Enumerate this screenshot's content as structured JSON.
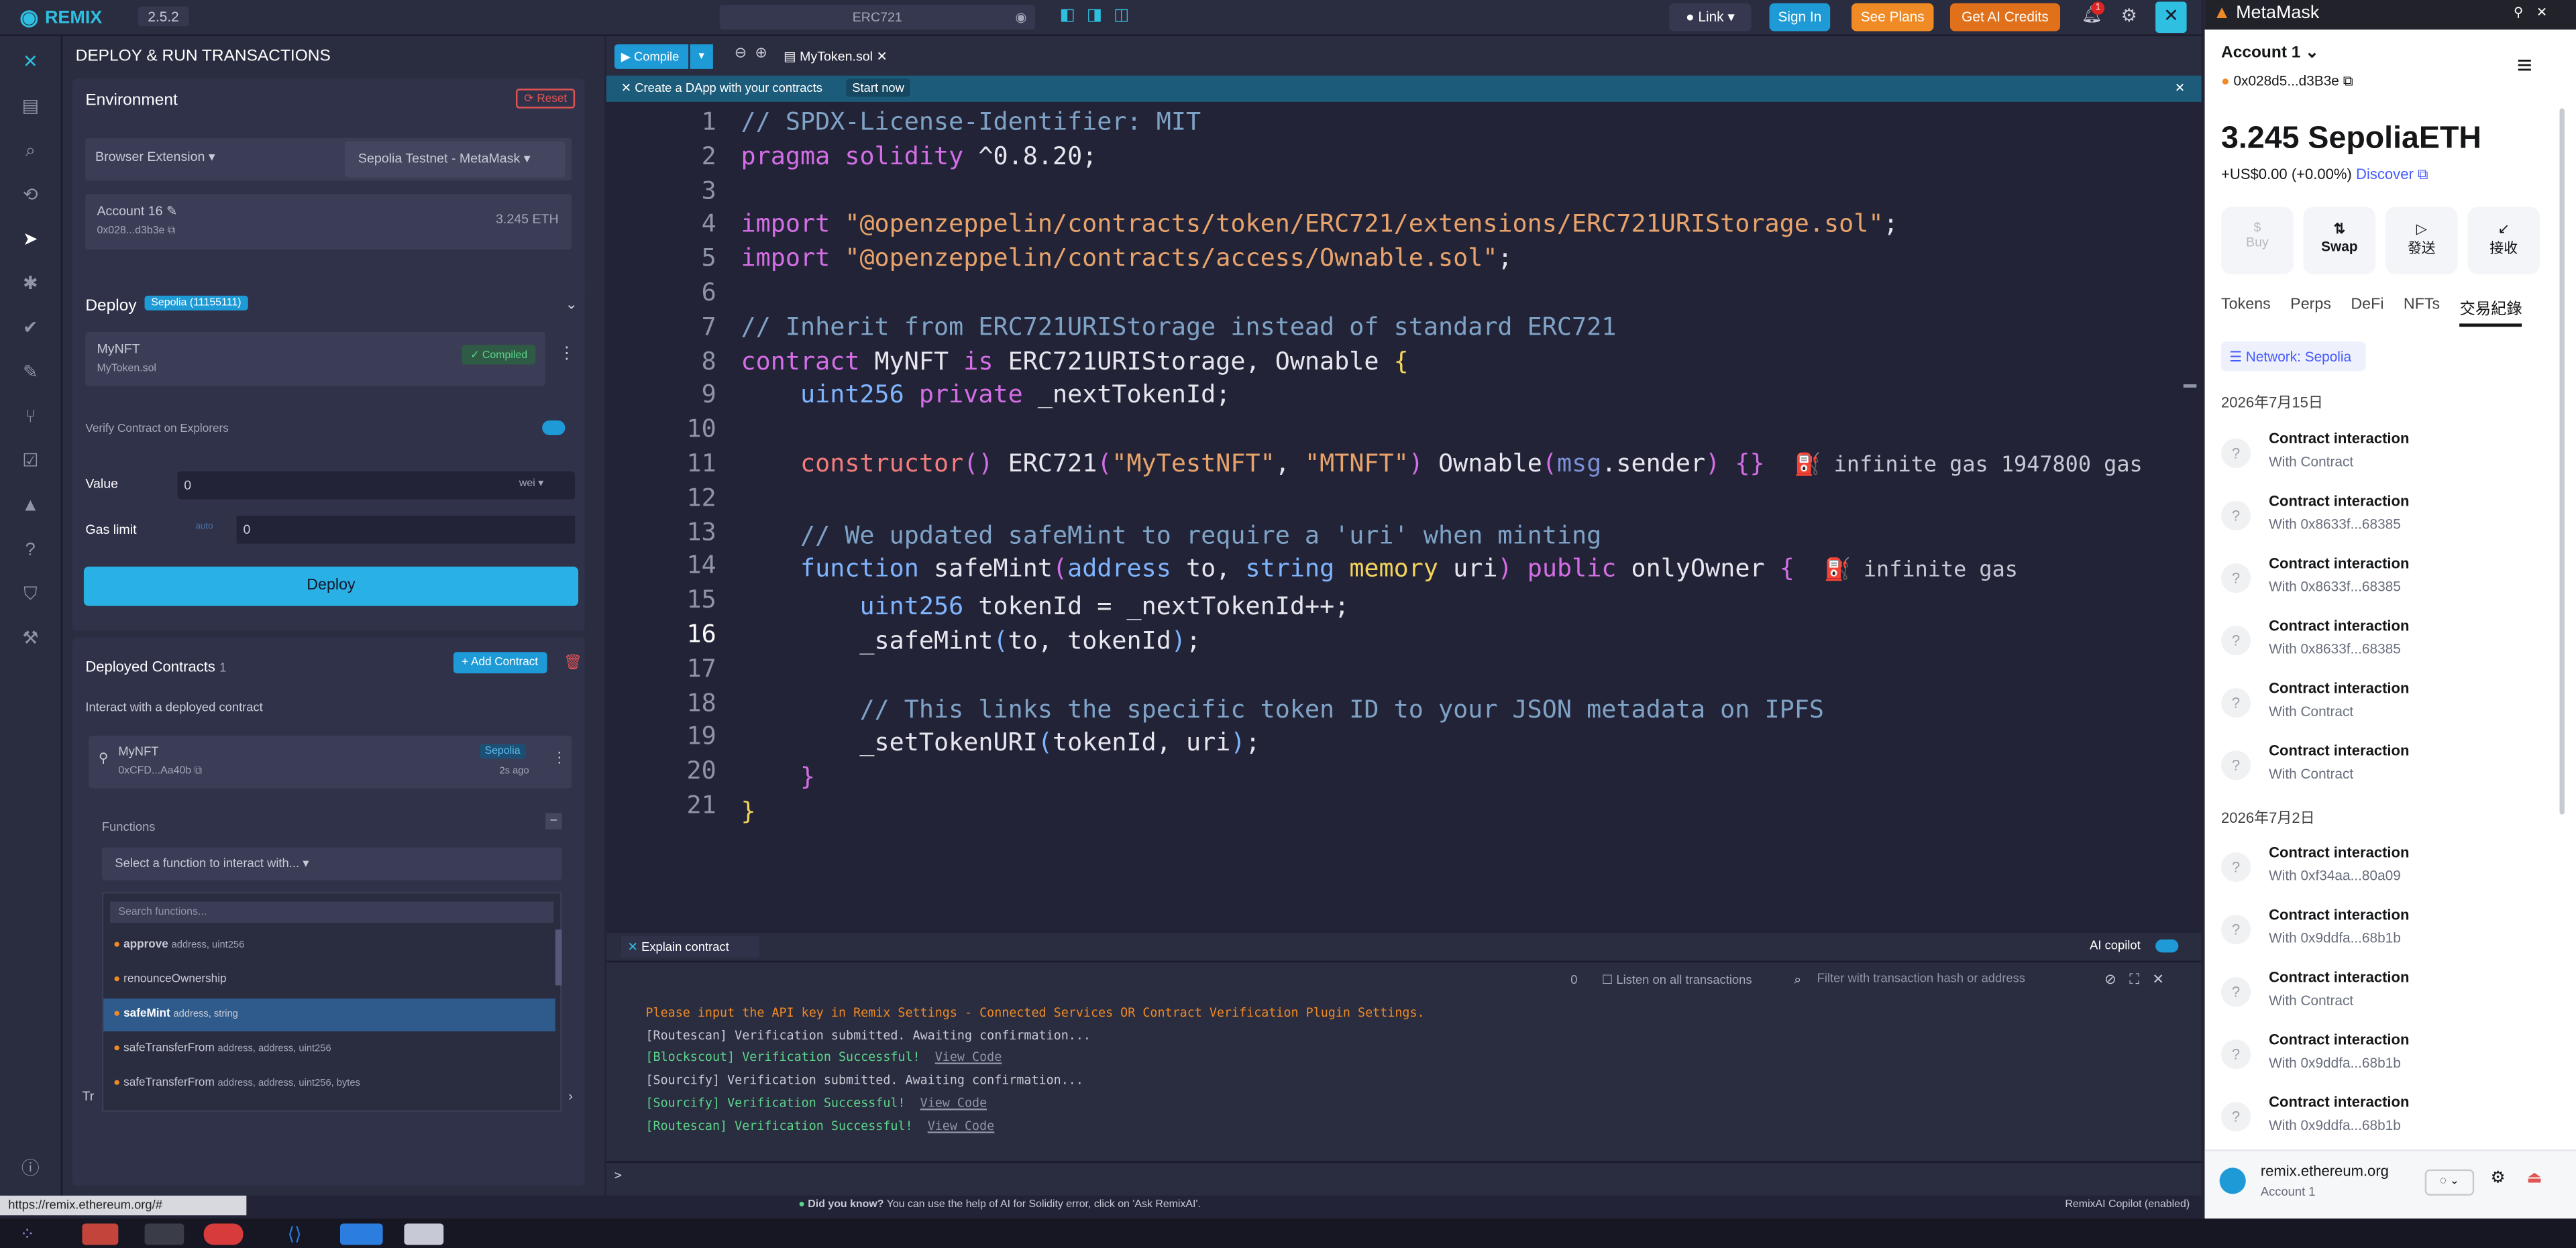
{
  "topbar": {
    "brand": "REMIX",
    "version": "2.5.2",
    "workspace": "ERC721",
    "link": "Link",
    "sign_in": "Sign In",
    "see_plans": "See Plans",
    "ai_credits": "Get AI Credits",
    "notif_count": "1"
  },
  "side": {
    "title": "DEPLOY & RUN TRANSACTIONS",
    "environment": "Environment",
    "reset": "Reset",
    "provider": "Browser Extension",
    "network": "Sepolia Testnet - MetaMask",
    "account": "Account 16",
    "account_addr": "0x028...d3b3e",
    "balance": "3.245 ETH",
    "deploy": "Deploy",
    "deploy_badge": "Sepolia (11155111)",
    "contract": "MyNFT",
    "contract_file": "MyToken.sol",
    "compiled": "Compiled",
    "verify": "Verify Contract on Explorers",
    "value_label": "Value",
    "value": "0",
    "unit": "wei",
    "gas_label": "Gas limit",
    "gas_auto": "auto",
    "gas_value": "0",
    "deploy_btn": "Deploy",
    "deployed_title": "Deployed Contracts",
    "deployed_count": "1",
    "add_contract": "Add Contract",
    "interact": "Interact with a deployed contract",
    "inst_name": "MyNFT",
    "inst_addr": "0xCFD...Aa40b",
    "inst_net": "Sepolia",
    "inst_time": "2s ago",
    "functions": "Functions",
    "fn_select": "Select a function to interact with...",
    "fn_search": "Search functions...",
    "fns": [
      {
        "name": "approve",
        "args": "address, uint256"
      },
      {
        "name": "renounceOwnership",
        "args": ""
      },
      {
        "name": "safeMint",
        "args": "address, string"
      },
      {
        "name": "safeTransferFrom",
        "args": "address, address, uint256"
      },
      {
        "name": "safeTransferFrom",
        "args": "address, address, uint256, bytes"
      }
    ],
    "hidden_prefix": "Tr"
  },
  "editor": {
    "compile": "Compile",
    "tab": "MyToken.sol",
    "banner": "Create a DApp with your contracts",
    "start_now": "Start now",
    "explain": "Explain contract",
    "ai_copilot": "AI copilot",
    "lines": [
      "1",
      "2",
      "3",
      "4",
      "5",
      "6",
      "7",
      "8",
      "9",
      "10",
      "11",
      "12",
      "13",
      "14",
      "15",
      "16",
      "17",
      "18",
      "19",
      "20",
      "21"
    ],
    "gas1": "infinite gas 1947800 gas",
    "gas2": "infinite gas"
  },
  "terminal": {
    "count": "0",
    "listen": "Listen on all transactions",
    "filter": "Filter with transaction hash or address",
    "l1": "Please input the API key in Remix Settings - Connected Services OR Contract Verification Plugin Settings.",
    "l2": "[Routescan] Verification submitted. Awaiting confirmation...",
    "l3": "[Blockscout] Verification Successful!",
    "l4": "[Sourcify] Verification submitted. Awaiting confirmation...",
    "l5": "[Sourcify] Verification Successful!",
    "l6": "[Routescan] Verification Successful!",
    "view_code": "View Code",
    "prompt": ">"
  },
  "status": {
    "url": "https://remix.ethereum.org/#",
    "tip_label": "Did you know?",
    "tip": "You can use the help of AI for Solidity error, click on 'Ask RemixAI'.",
    "copilot": "RemixAI Copilot (enabled)"
  },
  "metamask": {
    "title": "MetaMask",
    "account": "Account 1",
    "addr": "0x028d5...d3B3e",
    "balance": "3.245 SepoliaETH",
    "fiat": "+US$0.00 (+0.00%)",
    "discover": "Discover",
    "actions": [
      "Buy",
      "Swap",
      "發送",
      "接收"
    ],
    "tabs": [
      "Tokens",
      "Perps",
      "DeFi",
      "NFTs",
      "交易紀錄"
    ],
    "network_filter": "Network: Sepolia",
    "date1": "2026年7月15日",
    "date2": "2026年7月2日",
    "tx1": [
      {
        "t": "Contract interaction",
        "s": "With Contract"
      },
      {
        "t": "Contract interaction",
        "s": "With 0x8633f...68385"
      },
      {
        "t": "Contract interaction",
        "s": "With 0x8633f...68385"
      },
      {
        "t": "Contract interaction",
        "s": "With 0x8633f...68385"
      },
      {
        "t": "Contract interaction",
        "s": "With Contract"
      },
      {
        "t": "Contract interaction",
        "s": "With Contract"
      }
    ],
    "tx2": [
      {
        "t": "Contract interaction",
        "s": "With 0xf34aa...80a09"
      },
      {
        "t": "Contract interaction",
        "s": "With 0x9ddfa...68b1b"
      },
      {
        "t": "Contract interaction",
        "s": "With Contract"
      },
      {
        "t": "Contract interaction",
        "s": "With 0x9ddfa...68b1b"
      },
      {
        "t": "Contract interaction",
        "s": "With 0x9ddfa...68b1b"
      }
    ],
    "site": "remix.ethereum.org",
    "site_account": "Account 1"
  }
}
